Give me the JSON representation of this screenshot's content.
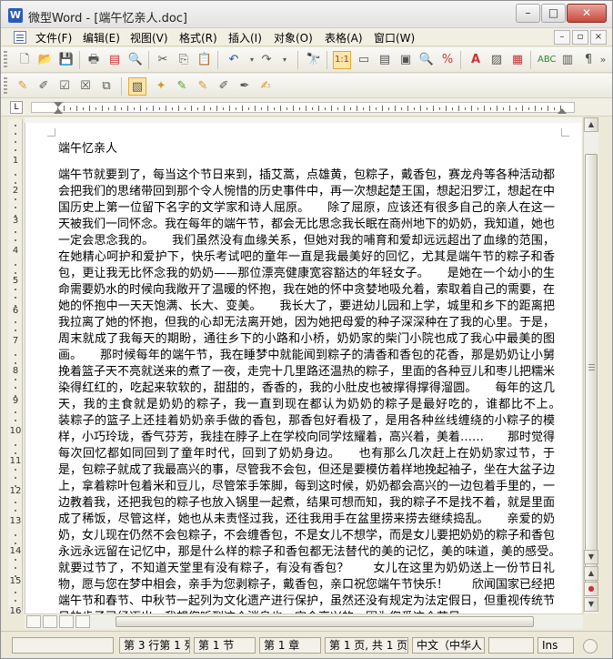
{
  "window": {
    "app_name": "微型Word",
    "title": "微型Word - [端午忆亲人.doc]",
    "buttons": {
      "minimize": "–",
      "maximize": "□",
      "close": "✕"
    }
  },
  "menubar": {
    "items": [
      "文件(F)",
      "编辑(E)",
      "视图(V)",
      "格式(R)",
      "插入(I)",
      "对象(O)",
      "表格(A)",
      "窗口(W)"
    ],
    "doc_buttons": [
      "–",
      "▫",
      "×"
    ]
  },
  "toolbar1": {
    "icons": [
      "new-doc-icon",
      "open-folder-icon",
      "save-icon",
      "print-icon",
      "pdf-icon",
      "print-preview-icon",
      "cut-icon",
      "copy-icon",
      "paste-icon",
      "undo-icon",
      "redo-icon",
      "find-icon",
      "page-view-icon",
      "normal-view-icon",
      "outline-view-icon",
      "web-view-icon",
      "zoom-icon",
      "percent-icon",
      "font-color-icon",
      "insert-picture-icon",
      "insert-table-icon",
      "spell-check-icon",
      "columns-icon",
      "paragraph-icon"
    ],
    "more": "»"
  },
  "toolbar2": {
    "icons": [
      "style-edit-icon",
      "track-change-icon",
      "accept-change-icon",
      "reject-change-icon",
      "compare-icon",
      "copy-format-icon",
      "star-icon",
      "highlight-icon",
      "underline-mark-icon",
      "bookmark-icon",
      "pen-icon",
      "note-icon"
    ]
  },
  "ruler": {
    "corner": "L",
    "numbers": [
      "1",
      "2",
      "3",
      "4",
      "5",
      "6",
      "7",
      "8",
      "9",
      "10",
      "11",
      "12",
      "13",
      "14",
      "15",
      "16"
    ]
  },
  "document": {
    "title": "端午忆亲人",
    "body": "端午节就要到了，每当这个节日来到，插艾蒿，点雄黄，包粽子，戴香包，赛龙舟等各种活动都会把我们的思绪带回到那个令人惋惜的历史事件中，再一次想起楚王国，想起汨罗江，想起在中国历史上第一位留下名字的文学家和诗人屈原。　　除了屈原，应该还有很多自己的亲人在这一天被我们一同怀念。我在每年的端午节，都会无比思念我长眠在商州地下的奶奶，我知道，她也一定会思念我的。　　我们虽然没有血缘关系，但她对我的哺育和爱却远远超出了血缘的范围，在她精心呵护和爱护下，快乐考试吧的童年一直是我最美好的回忆，尤其是端午节的粽子和香包，更让我无比怀念我的奶奶——那位漂亮健康宽容豁达的年轻女子。　　是她在一个幼小的生命需要奶水的时候向我敞开了温暖的怀抱，我在她的怀中贪婪地吸允着，索取着自己的需要，在她的怀抱中一天天饱满、长大、变美。　　我长大了，要进幼儿园和上学，城里和乡下的距离把我拉离了她的怀抱，但我的心却无法离开她，因为她把母爱的种子深深种在了我的心里。于是，周末就成了我每天的期盼，通往乡下的小路和小桥，奶奶家的柴门小院也成了我心中最美的图画。　　那时候每年的端午节，我在睡梦中就能闻到粽子的清香和香包的花香，那是奶奶让小舅挽着篮子天不亮就送来的煮了一夜，走完十几里路还温热的粽子，里面的各种豆儿和枣儿把糯米染得红红的，吃起来软软的，甜甜的，香香的，我的小肚皮也被撑得撑得溜圆。　　每年的这几天，我的主食就是奶奶的粽子，我一直到现在都认为奶奶的粽子是最好吃的，谁都比不上。　　装粽子的篮子上还挂着奶奶亲手做的香包，那香包好看极了，是用各种丝线缠绕的小粽子的模样，小巧玲珑，香气芬芳，我挂在脖子上在学校向同学炫耀着，高兴着，美着……　　那时觉得每次回忆都如同回到了童年时代，回到了奶奶身边。　　也有那么几次赶上在奶奶家过节，于是，包粽子就成了我最高兴的事，尽管我不会包，但还是要模仿着样地挽起袖子，坐在大盆子边上，拿着粽叶包着米和豆儿，尽管笨手笨脚，每到这时候，奶奶都会高兴的一边包着手里的，一边教着我，还把我包的粽子也放入锅里一起煮，结果可想而知，我的粽子不是找不着，就是里面成了稀饭，尽管这样，她也从未责怪过我，还往我用手在盆里捞来捞去继续捣乱。　　亲爱的奶奶，女儿现在仍然不会包粽子，不会缠香包，不是女儿不想学，而是女儿要把奶奶的粽子和香包永远永远留在记忆中，那是什么样的粽子和香包都无法替代的美的记忆，美的味道，美的感受。　　就要过节了，不知道天堂里有没有粽子，有没有香包？　　女儿在这里为奶奶送上一份节日礼物，愿与您在梦中相会，亲手为您剥粽子，戴香包，亲口祝您端午节快乐！　　欣闻国家已经把端午节和春节、中秋节一起列为文化遗产进行保护，虽然还没有规定为法定假日，但重视传统节日的步子已经迈出，我想您听到这个消息也一定会高兴的，因为您爱这个节日"
  },
  "scrollbar": {
    "up": "▲",
    "down": "▼",
    "prev_page": "▲",
    "select_browse": "●",
    "next_page": "▼"
  },
  "statusbar": {
    "position": "第 3 行第 1 列",
    "section": "第 1 节",
    "chapter": "第 1 章",
    "page": "第 1 页, 共 1 页",
    "language": "中文（中华人",
    "mode": "Ins"
  }
}
